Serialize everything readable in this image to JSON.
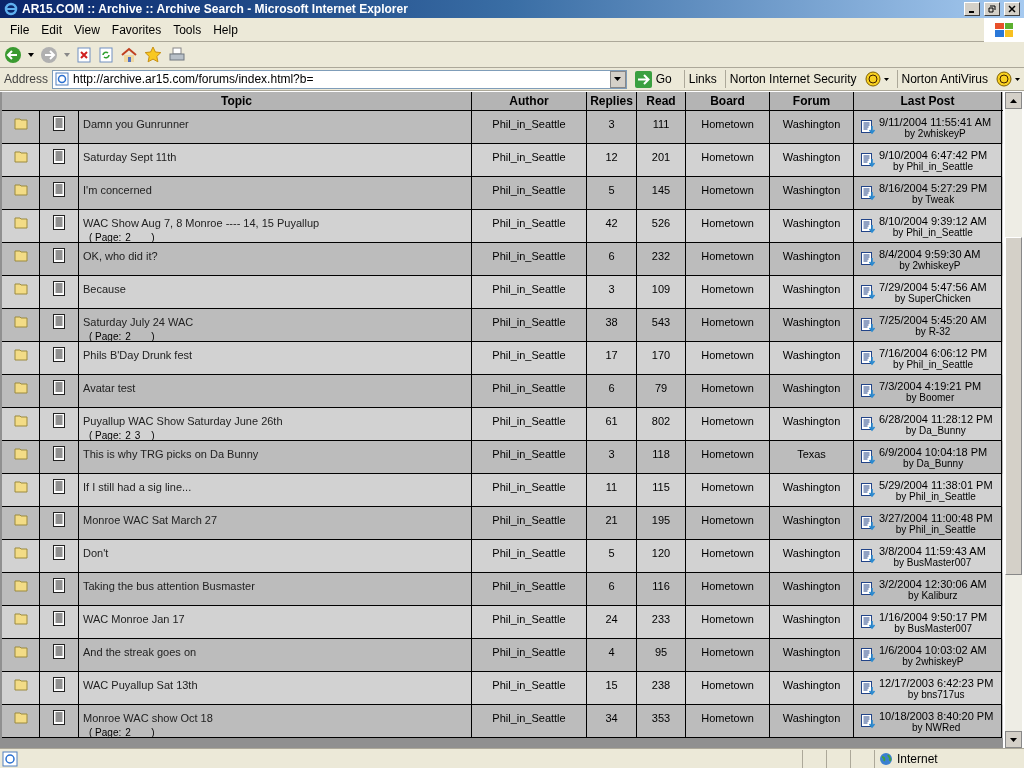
{
  "window": {
    "title": "AR15.COM :: Archive :: Archive Search - Microsoft Internet Explorer"
  },
  "menu": [
    "File",
    "Edit",
    "View",
    "Favorites",
    "Tools",
    "Help"
  ],
  "address": {
    "label": "Address",
    "value": "http://archive.ar15.com/forums/index.html?b=",
    "go": "Go"
  },
  "links": {
    "label": "Links",
    "items": [
      "Norton Internet Security",
      "Norton AntiVirus"
    ]
  },
  "table": {
    "columns": [
      "Topic",
      "Author",
      "Replies",
      "Read",
      "Board",
      "Forum",
      "Last Post"
    ],
    "rows": [
      {
        "topic": "Damn you Gunrunner",
        "author": "Phil_in_Seattle",
        "replies": "3",
        "read": "111",
        "board": "Hometown",
        "forum": "Washington",
        "last_post": "9/11/2004 11:55:41 AM",
        "last_by": "by 2whiskeyP"
      },
      {
        "topic": "Saturday Sept 11th",
        "author": "Phil_in_Seattle",
        "replies": "12",
        "read": "201",
        "board": "Hometown",
        "forum": "Washington",
        "last_post": "9/10/2004 6:47:42 PM",
        "last_by": "by Phil_in_Seattle"
      },
      {
        "topic": "I'm concerned",
        "author": "Phil_in_Seattle",
        "replies": "5",
        "read": "145",
        "board": "Hometown",
        "forum": "Washington",
        "last_post": "8/16/2004 5:27:29 PM",
        "last_by": "by Tweak"
      },
      {
        "topic": "WAC Show Aug 7, 8 Monroe ---- 14, 15 Puyallup",
        "pages_open": "( Page:",
        "pages": [
          "2"
        ],
        "pages_close": ")",
        "author": "Phil_in_Seattle",
        "replies": "42",
        "read": "526",
        "board": "Hometown",
        "forum": "Washington",
        "last_post": "8/10/2004 9:39:12 AM",
        "last_by": "by Phil_in_Seattle"
      },
      {
        "topic": "OK, who did it?",
        "author": "Phil_in_Seattle",
        "replies": "6",
        "read": "232",
        "board": "Hometown",
        "forum": "Washington",
        "last_post": "8/4/2004 9:59:30 AM",
        "last_by": "by 2whiskeyP"
      },
      {
        "topic": "Because",
        "author": "Phil_in_Seattle",
        "replies": "3",
        "read": "109",
        "board": "Hometown",
        "forum": "Washington",
        "last_post": "7/29/2004 5:47:56 AM",
        "last_by": "by SuperChicken"
      },
      {
        "topic": "Saturday July 24 WAC",
        "pages_open": "( Page:",
        "pages": [
          "2"
        ],
        "pages_close": ")",
        "author": "Phil_in_Seattle",
        "replies": "38",
        "read": "543",
        "board": "Hometown",
        "forum": "Washington",
        "last_post": "7/25/2004 5:45:20 AM",
        "last_by": "by R-32"
      },
      {
        "topic": "Phils B'Day Drunk fest",
        "author": "Phil_in_Seattle",
        "replies": "17",
        "read": "170",
        "board": "Hometown",
        "forum": "Washington",
        "last_post": "7/16/2004 6:06:12 PM",
        "last_by": "by Phil_in_Seattle"
      },
      {
        "topic": "Avatar test",
        "author": "Phil_in_Seattle",
        "replies": "6",
        "read": "79",
        "board": "Hometown",
        "forum": "Washington",
        "last_post": "7/3/2004 4:19:21 PM",
        "last_by": "by Boomer"
      },
      {
        "topic": "Puyallup WAC Show Saturday June 26th",
        "pages_open": "( Page:",
        "pages": [
          "2",
          "3"
        ],
        "pages_close": ")",
        "author": "Phil_in_Seattle",
        "replies": "61",
        "read": "802",
        "board": "Hometown",
        "forum": "Washington",
        "last_post": "6/28/2004 11:28:12 PM",
        "last_by": "by Da_Bunny"
      },
      {
        "topic": "This is why TRG picks on Da Bunny",
        "author": "Phil_in_Seattle",
        "replies": "3",
        "read": "118",
        "board": "Hometown",
        "forum": "Texas",
        "last_post": "6/9/2004 10:04:18 PM",
        "last_by": "by Da_Bunny"
      },
      {
        "topic": "If I still had a sig line...",
        "author": "Phil_in_Seattle",
        "replies": "11",
        "read": "115",
        "board": "Hometown",
        "forum": "Washington",
        "last_post": "5/29/2004 11:38:01 PM",
        "last_by": "by Phil_in_Seattle"
      },
      {
        "topic": "Monroe WAC Sat March 27",
        "author": "Phil_in_Seattle",
        "replies": "21",
        "read": "195",
        "board": "Hometown",
        "forum": "Washington",
        "last_post": "3/27/2004 11:00:48 PM",
        "last_by": "by Phil_in_Seattle"
      },
      {
        "topic": "Don't",
        "author": "Phil_in_Seattle",
        "replies": "5",
        "read": "120",
        "board": "Hometown",
        "forum": "Washington",
        "last_post": "3/8/2004 11:59:43 AM",
        "last_by": "by BusMaster007"
      },
      {
        "topic": "Taking the bus attention Busmaster",
        "author": "Phil_in_Seattle",
        "replies": "6",
        "read": "116",
        "board": "Hometown",
        "forum": "Washington",
        "last_post": "3/2/2004 12:30:06 AM",
        "last_by": "by Kaliburz"
      },
      {
        "topic": "WAC Monroe Jan 17",
        "author": "Phil_in_Seattle",
        "replies": "24",
        "read": "233",
        "board": "Hometown",
        "forum": "Washington",
        "last_post": "1/16/2004 9:50:17 PM",
        "last_by": "by BusMaster007"
      },
      {
        "topic": "And the streak goes on",
        "author": "Phil_in_Seattle",
        "replies": "4",
        "read": "95",
        "board": "Hometown",
        "forum": "Washington",
        "last_post": "1/6/2004 10:03:02 AM",
        "last_by": "by 2whiskeyP"
      },
      {
        "topic": "WAC Puyallup Sat 13th",
        "author": "Phil_in_Seattle",
        "replies": "15",
        "read": "238",
        "board": "Hometown",
        "forum": "Washington",
        "last_post": "12/17/2003 6:42:23 PM",
        "last_by": "by bns717us"
      },
      {
        "topic": "Monroe WAC show Oct 18",
        "pages_open": "( Page:",
        "pages": [
          "2"
        ],
        "pages_close": ")",
        "author": "Phil_in_Seattle",
        "replies": "34",
        "read": "353",
        "board": "Hometown",
        "forum": "Washington",
        "last_post": "10/18/2003 8:40:20 PM",
        "last_by": "by NWRed"
      }
    ]
  },
  "status_bar": {
    "zone": "Internet"
  }
}
